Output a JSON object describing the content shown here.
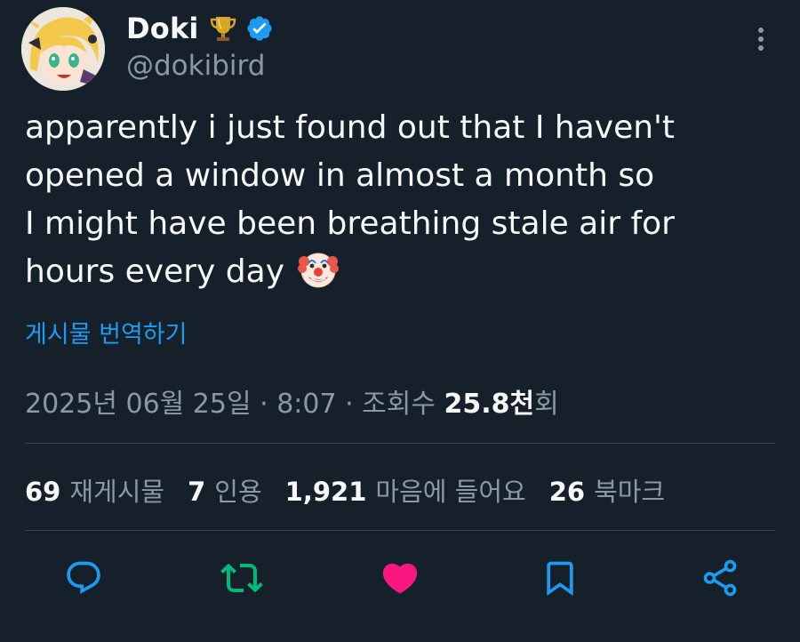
{
  "user": {
    "display_name": "Doki",
    "handle": "@dokibird",
    "badges": [
      "trophy-icon",
      "verified-icon"
    ]
  },
  "tweet": {
    "text_lines": [
      "apparently i just found out that I haven't",
      "opened a window in almost a month so",
      "I might have been breathing stale air for",
      "hours every day"
    ],
    "emoji": "clown-face-icon",
    "translate_label": "게시물 번역하기"
  },
  "meta": {
    "date": "2025년 06월 25일",
    "separator": " · ",
    "time": "8:07",
    "views_prefix": "조회수 ",
    "views_value": "25.8천",
    "views_suffix": "회"
  },
  "stats": [
    {
      "value": "69",
      "label": "재게시물"
    },
    {
      "value": "7",
      "label": "인용"
    },
    {
      "value": "1,921",
      "label": "마음에 들어요"
    },
    {
      "value": "26",
      "label": "북마크"
    }
  ],
  "actions": [
    {
      "name": "reply-icon",
      "color": "#1d9bf0"
    },
    {
      "name": "repost-icon",
      "color": "#00ba7c"
    },
    {
      "name": "like-icon",
      "color": "#f91880"
    },
    {
      "name": "bookmark-icon",
      "color": "#1d9bf0"
    },
    {
      "name": "share-icon",
      "color": "#1d9bf0"
    }
  ],
  "colors": {
    "background": "#15202b",
    "text": "#f7f9f9",
    "muted": "#8b98a5",
    "link": "#1d9bf0",
    "divider": "#38444d"
  }
}
